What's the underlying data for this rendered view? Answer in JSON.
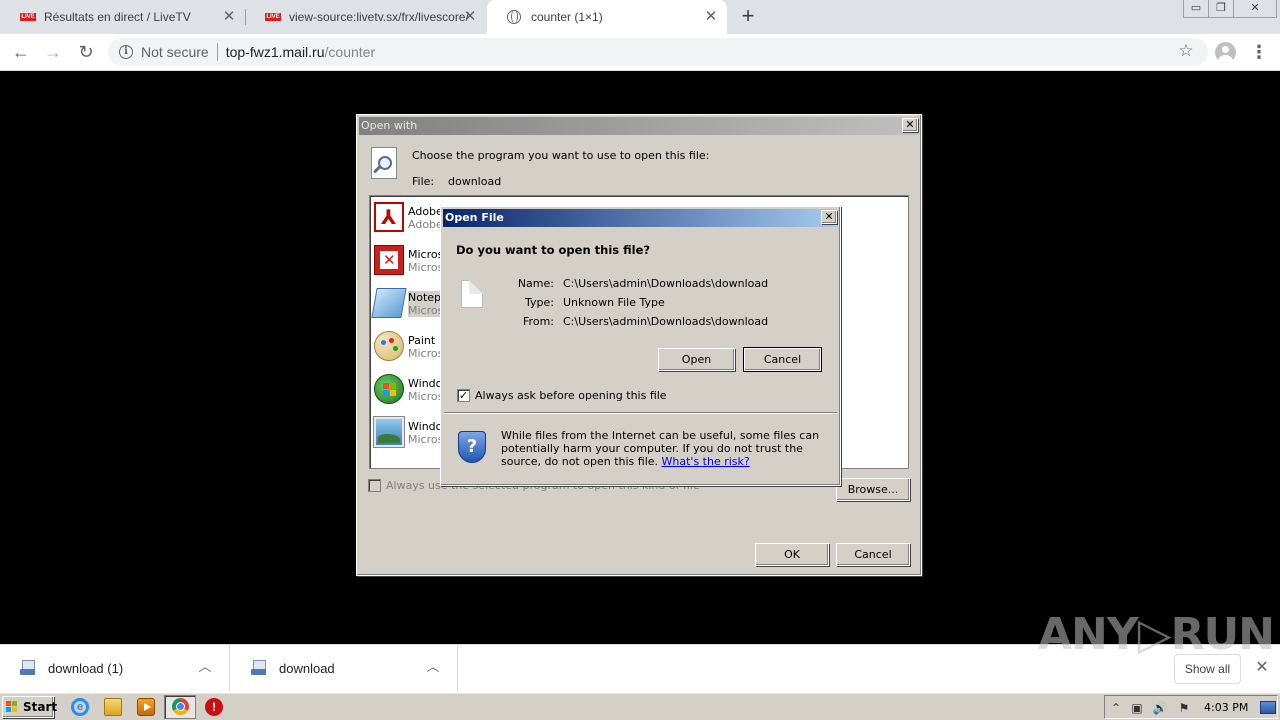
{
  "tabs": [
    {
      "label": "Résultats en direct / LiveTV",
      "icon": "live-icon",
      "favicon_text": "LIVE",
      "active": false
    },
    {
      "label": "view-source:livetv.sx/frx/livescore/",
      "icon": "live-icon",
      "favicon_text": "LIVE",
      "active": false
    },
    {
      "label": "counter (1×1)",
      "icon": "globe-icon",
      "active": true
    }
  ],
  "window_controls": {
    "minimize": "▭",
    "restore": "❐",
    "close": "✕"
  },
  "toolbar": {
    "back": "←",
    "forward": "→",
    "reload": "↻",
    "security_text": "Not secure",
    "url_host": "top-fwz1.mail.ru",
    "url_path": "/counter",
    "star": "☆",
    "menu": "⋮"
  },
  "open_with": {
    "title": "Open with",
    "prompt": "Choose the program you want to use to open this file:",
    "file_label": "File:",
    "file_name": "download",
    "programs": [
      {
        "name": "Adobe",
        "vendor": "Adobe",
        "icon": "adobe-reader-icon"
      },
      {
        "name": "Micros",
        "vendor": "Micros",
        "icon": "ms-powerpoint-icon"
      },
      {
        "name": "Notepa",
        "vendor": "Micros",
        "icon": "notepad-icon",
        "selected": true
      },
      {
        "name": "Paint",
        "vendor": "Micros",
        "icon": "paint-icon"
      },
      {
        "name": "Windo",
        "vendor": "Micros",
        "icon": "windows-media-icon"
      },
      {
        "name": "Windo",
        "vendor": "Micros",
        "icon": "photo-viewer-icon"
      }
    ],
    "always_use_label": "Always use the selected program to open this kind of file",
    "browse_label": "Browse...",
    "ok_label": "OK",
    "cancel_label": "Cancel"
  },
  "open_file": {
    "title": "Open File",
    "close": "✕",
    "question": "Do you want to open this file?",
    "name_label": "Name:",
    "name_value": "C:\\Users\\admin\\Downloads\\download",
    "type_label": "Type:",
    "type_value": "Unknown File Type",
    "from_label": "From:",
    "from_value": "C:\\Users\\admin\\Downloads\\download",
    "open_label": "Open",
    "cancel_label": "Cancel",
    "always_ask_label": "Always ask before opening this file",
    "always_ask_checked": true,
    "check_mark": "✓",
    "warning_text": "While files from the Internet can be useful, some files can potentially harm your computer. If you do not trust the source, do not open this file. ",
    "risk_link": "What's the risk?",
    "shield_mark": "?"
  },
  "downloads": [
    {
      "name": "download (1)",
      "chevron": "︿"
    },
    {
      "name": "download",
      "chevron": "︿"
    }
  ],
  "download_bar": {
    "show_all": "Show all",
    "close": "✕",
    "watermark": "ANY▷RUN"
  },
  "taskbar": {
    "start_label": "Start",
    "ie_glyph": "e",
    "stop_glyph": "!",
    "clock": "4:03 PM",
    "tray": [
      "⌃",
      "▣",
      "🔊",
      "⚑"
    ]
  }
}
